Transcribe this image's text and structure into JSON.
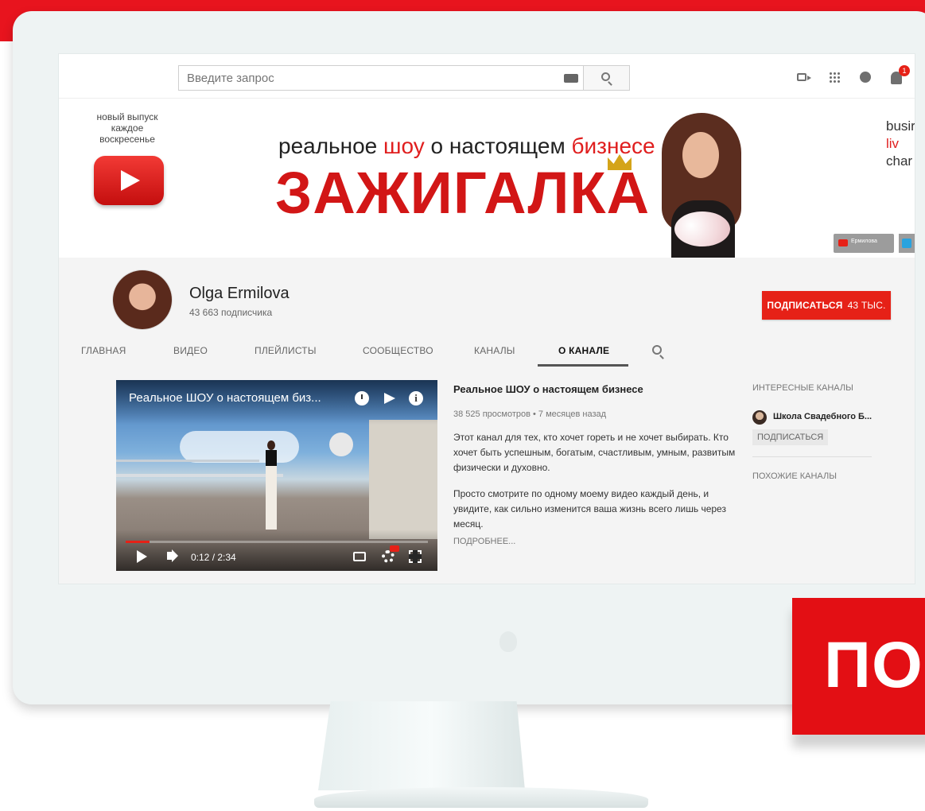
{
  "search": {
    "placeholder": "Введите запрос"
  },
  "notifications": {
    "count": "1"
  },
  "banner": {
    "tag": "новый выпуск каждое воскресенье",
    "subtitle_before": "реальное ",
    "subtitle_red1": "шоу",
    "subtitle_mid": " о настоящем ",
    "subtitle_red2": "бизнесе",
    "title": "ЗАЖИГАЛКА",
    "right_line1": "busir",
    "right_line2": "liv",
    "right_line3": "char",
    "social_chip": "Ермилова"
  },
  "channel": {
    "name": "Olga Ermilova",
    "subscribers": "43 663 подписчика",
    "subscribe_label": "ПОДПИСАТЬСЯ",
    "subscribe_count": "43 ТЫС."
  },
  "tabs": [
    {
      "label": "ГЛАВНАЯ"
    },
    {
      "label": "ВИДЕО"
    },
    {
      "label": "ПЛЕЙЛИСТЫ"
    },
    {
      "label": "СООБЩЕСТВО"
    },
    {
      "label": "КАНАЛЫ"
    },
    {
      "label": "О КАНАЛЕ"
    }
  ],
  "video": {
    "title": "Реальное ШОУ о настоящем биз...",
    "time": "0:12 / 2:34",
    "progress": 0.078
  },
  "about": {
    "title": "Реальное ШОУ о настоящем бизнесе",
    "meta": "38 525 просмотров • 7 месяцев назад",
    "p1": "Этот канал для тех, кто хочет гореть и не хочет выбирать. Кто хочет быть успешным, богатым, счастливым, умным, развитым физически и духовно.",
    "p2": "Просто смотрите по одному моему видео каждый день, и увидите, как сильно изменится ваша жизнь всего лишь через месяц.",
    "more": "ПОДРОБНЕЕ..."
  },
  "sidebar": {
    "interesting_heading": "ИНТЕРЕСНЫЕ КАНАЛЫ",
    "channel_name": "Школа Свадебного Б...",
    "subscribe_label": "ПОДПИСАТЬСЯ",
    "similar_heading": "ПОХОЖИЕ КАНАЛЫ"
  },
  "callout": {
    "text": "ПО"
  },
  "colors": {
    "brand_red": "#e62117",
    "page_red": "#e8141e"
  }
}
